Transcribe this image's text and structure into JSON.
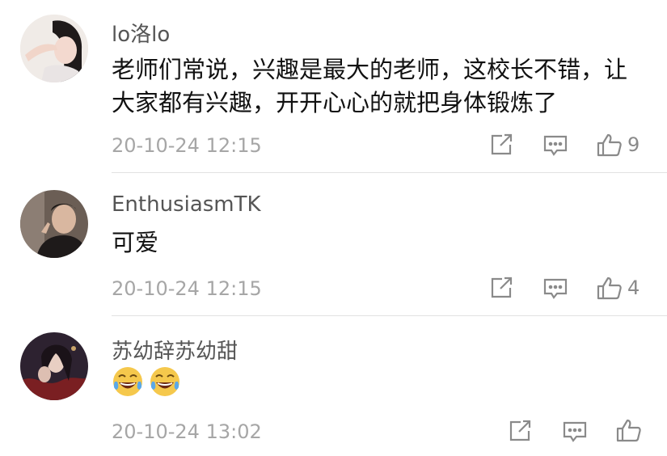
{
  "comments": [
    {
      "username": "lo洛lo",
      "text": "老师们常说，兴趣是最大的老师，这校长不错，让大家都有兴趣，开开心心的就把身体锻炼了",
      "timestamp": "20-10-24 12:15",
      "likes": "9",
      "icons": [
        "share-icon",
        "reply-icon",
        "like-icon"
      ]
    },
    {
      "username": "EnthusiasmTK",
      "text": "可爱",
      "timestamp": "20-10-24 12:15",
      "likes": "4",
      "icons": [
        "share-icon",
        "reply-icon",
        "like-icon"
      ]
    },
    {
      "username": "苏幼辞苏幼甜",
      "emojis": [
        "laugh-cry-emoji",
        "laugh-cry-emoji"
      ],
      "timestamp": "20-10-24 13:02",
      "likes": "",
      "icons": [
        "share-icon",
        "reply-icon",
        "like-icon"
      ]
    }
  ],
  "colors": {
    "text": "#111111",
    "username": "#555555",
    "meta": "#a6a6a6",
    "divider": "#e2e2e2",
    "emoji": "#f5c84c"
  }
}
